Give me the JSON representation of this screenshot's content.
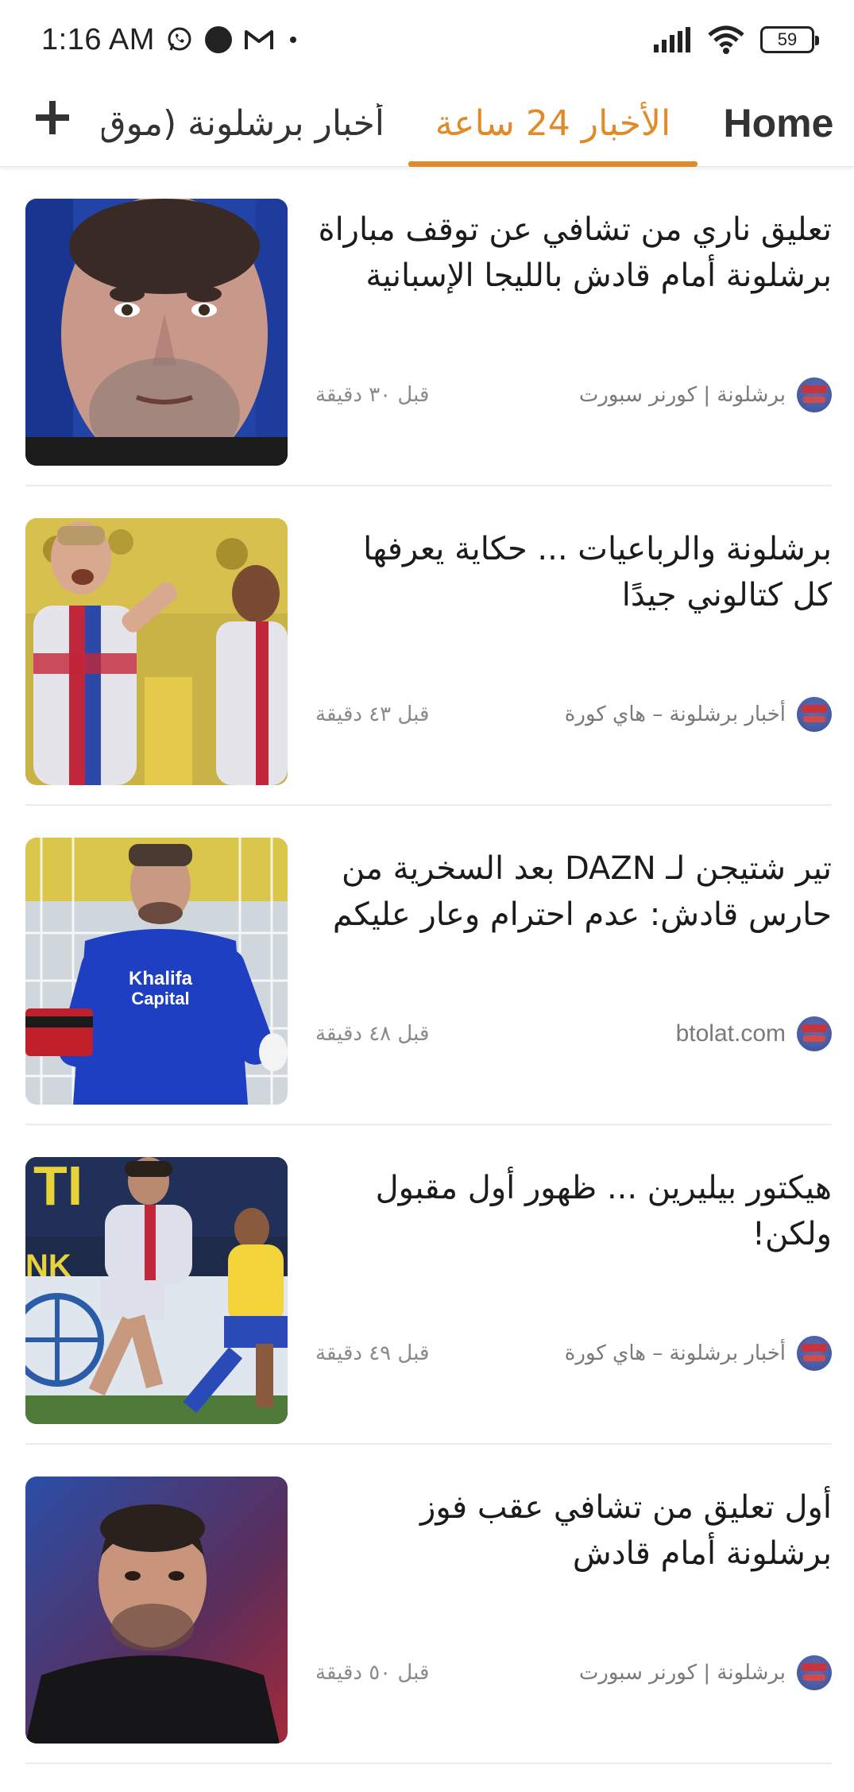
{
  "status_bar": {
    "time": "1:16 AM",
    "battery": "59",
    "icons": [
      "whatsapp-icon",
      "dot-icon",
      "gmail-icon",
      "small-dot-icon",
      "signal-icon",
      "wifi-icon",
      "battery-icon"
    ]
  },
  "tabs": {
    "add_icon": "plus-icon",
    "items": [
      {
        "label": "Home",
        "active": false
      },
      {
        "label": "الأخبار 24 ساعة",
        "active": true
      },
      {
        "label": "أخبار برشلونة (موقِ",
        "active": false
      }
    ],
    "accent_color": "#e08a2a"
  },
  "articles": [
    {
      "title": "تعليق ناري من تشافي عن توقف مباراة برشلونة أمام قادش بالليجا الإسبانية",
      "source": "برشلونة | كورنر سبورت",
      "time_ago": "قبل ٣٠ دقيقة",
      "image": "xavi-closeup-photo"
    },
    {
      "title": "برشلونة والرباعيات ... حكاية يعرفها كل كتالوني جيدًا",
      "source": "أخبار برشلونة – هاي كورة",
      "time_ago": "قبل ٤٣ دقيقة",
      "image": "barcelona-players-celebrating-photo"
    },
    {
      "title": "تير شتيجن لـ DAZN بعد السخرية من حارس قادش: عدم احترام وعار عليكم",
      "source": "btolat.com",
      "time_ago": "قبل ٤٨ دقيقة",
      "image": "cadiz-goalkeeper-photo"
    },
    {
      "title": "هيكتور بيليرين ... ظهور أول مقبول ولكن!",
      "source": "أخبار برشلونة – هاي كورة",
      "time_ago": "قبل ٤٩ دقيقة",
      "image": "bellerin-match-photo"
    },
    {
      "title": "أول تعليق من تشافي عقب فوز برشلونة أمام قادش",
      "source": "برشلونة | كورنر سبورت",
      "time_ago": "قبل ٥٠ دقيقة",
      "image": "xavi-sideline-photo"
    }
  ]
}
